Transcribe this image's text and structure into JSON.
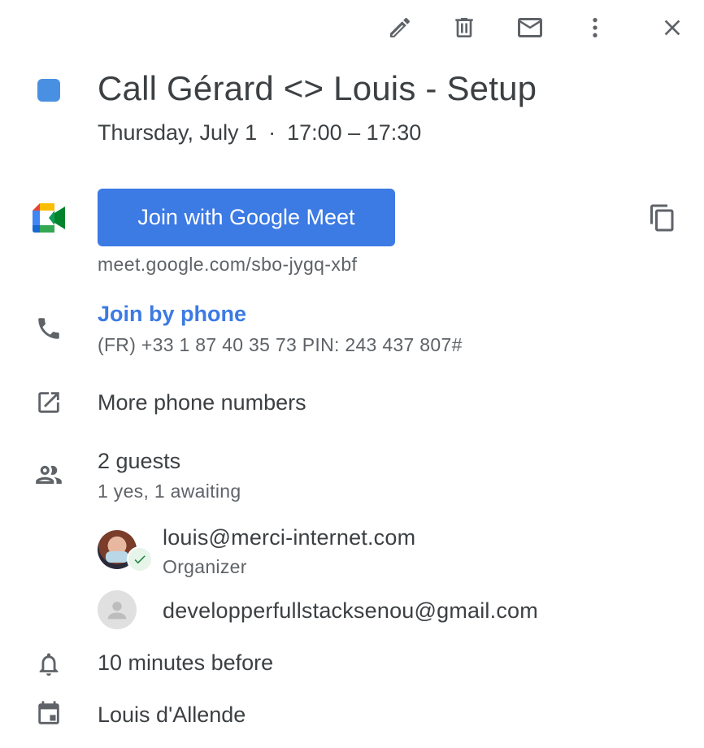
{
  "toolbar": {
    "edit_icon": "pencil-icon",
    "delete_icon": "trash-icon",
    "email_icon": "mail-icon",
    "more_icon": "more-vert-icon",
    "close_icon": "close-icon"
  },
  "event": {
    "color": "#4a90e2",
    "title": "Call Gérard <> Louis - Setup",
    "date": "Thursday, July 1",
    "separator": "·",
    "time": "17:00 – 17:30"
  },
  "meet": {
    "button_label": "Join with Google Meet",
    "url": "meet.google.com/sbo-jygq-xbf",
    "accent": "#3c7ae4"
  },
  "phone": {
    "link_label": "Join by phone",
    "detail": "(FR) +33 1 87 40 35 73 PIN: 243 437 807#"
  },
  "more_phones": {
    "label": "More phone numbers"
  },
  "guests": {
    "count_label": "2 guests",
    "status_label": "1 yes, 1 awaiting",
    "list": [
      {
        "email": "louis@merci-internet.com",
        "role": "Organizer"
      },
      {
        "email": "developperfullstacksenou@gmail.com",
        "role": ""
      }
    ]
  },
  "reminder": {
    "label": "10 minutes before"
  },
  "calendar": {
    "owner": "Louis d'Allende"
  }
}
